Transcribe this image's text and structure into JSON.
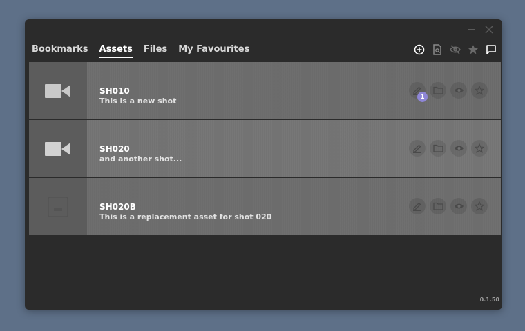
{
  "window": {
    "version": "0.1.50"
  },
  "tabs": [
    {
      "label": "Bookmarks",
      "active": false
    },
    {
      "label": "Assets",
      "active": true
    },
    {
      "label": "Files",
      "active": false
    },
    {
      "label": "My Favourites",
      "active": false
    }
  ],
  "toolbar": {
    "icons": [
      "add-circle-icon",
      "file-search-icon",
      "eye-off-icon",
      "star-icon",
      "comment-icon"
    ]
  },
  "assets": [
    {
      "name": "SH010",
      "description": "This is a new shot",
      "thumbnail": "video-camera-icon",
      "note_count": "1"
    },
    {
      "name": "SH020",
      "description": "and another shot...",
      "thumbnail": "video-camera-icon",
      "note_count": ""
    },
    {
      "name": "SH020B",
      "description": "This is a replacement asset for shot 020",
      "thumbnail": "image-placeholder-icon",
      "note_count": ""
    }
  ],
  "row_actions": [
    "edit-icon",
    "folder-icon",
    "eye-icon",
    "star-icon"
  ],
  "colors": {
    "background": "#5e7088",
    "window": "#2b2b2b",
    "badge": "#8e86d6"
  }
}
